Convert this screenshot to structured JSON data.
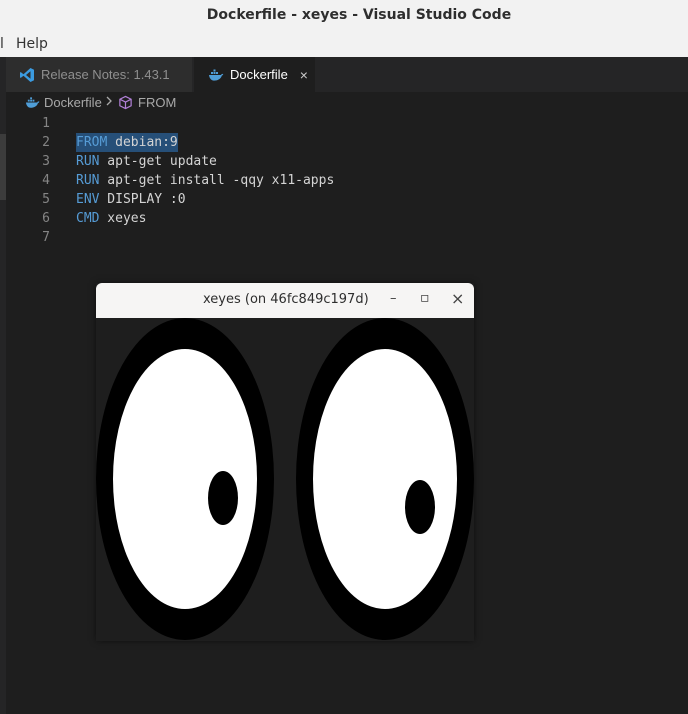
{
  "window_title": "Dockerfile - xeyes - Visual Studio Code",
  "menu": {
    "partial_item": "l",
    "help": "Help"
  },
  "tabs": [
    {
      "label": "Release Notes: 1.43.1",
      "icon": "vscode-logo-icon",
      "active": false
    },
    {
      "label": "Dockerfile",
      "icon": "docker-whale-icon",
      "active": true,
      "close": "×"
    }
  ],
  "breadcrumb": {
    "file": "Dockerfile",
    "separator": ">",
    "symbol": "FROM"
  },
  "editor": {
    "line_numbers": [
      "1",
      "2",
      "3",
      "4",
      "5",
      "6",
      "7"
    ],
    "lines": [
      {
        "kw": "",
        "rest": ""
      },
      {
        "kw": "FROM",
        "rest": " debian:9"
      },
      {
        "kw": "RUN",
        "rest": " apt-get update"
      },
      {
        "kw": "RUN",
        "rest": " apt-get install -qqy x11-apps"
      },
      {
        "kw": "ENV",
        "rest": " DISPLAY :0"
      },
      {
        "kw": "CMD",
        "rest": " xeyes"
      },
      {
        "kw": "",
        "rest": ""
      }
    ],
    "selected_line": 2
  },
  "xeyes_window": {
    "title": "xeyes (on 46fc849c197d)",
    "minimize": "–",
    "maximize": "▫",
    "close": "×"
  },
  "colors": {
    "keyword": "#569cd6",
    "editor_bg": "#1e1e1e",
    "selection": "#264f78"
  }
}
